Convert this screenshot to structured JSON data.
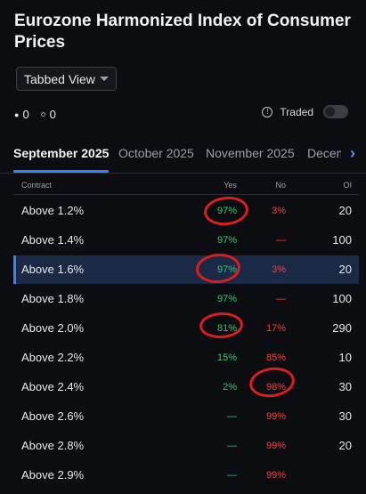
{
  "title": "Eurozone Harmonized Index of Consumer Prices",
  "view_select": {
    "value": "Tabbed View"
  },
  "counts": {
    "first": "0",
    "second": "0"
  },
  "traded": {
    "label": "Traded",
    "toggle_on": false
  },
  "tabs": [
    {
      "label": "September 2025",
      "active": true
    },
    {
      "label": "October 2025",
      "active": false
    },
    {
      "label": "November 2025",
      "active": false
    },
    {
      "label": "Decem",
      "active": false
    }
  ],
  "columns": {
    "contract": "Contract",
    "yes": "Yes",
    "no": "No",
    "oi": "OI"
  },
  "rows": [
    {
      "contract": "Above 1.2%",
      "yes": "97%",
      "no": "3%",
      "oi": "20"
    },
    {
      "contract": "Above 1.4%",
      "yes": "97%",
      "no": "—",
      "oi": "100"
    },
    {
      "contract": "Above 1.6%",
      "yes": "97%",
      "no": "3%",
      "oi": "20"
    },
    {
      "contract": "Above 1.8%",
      "yes": "97%",
      "no": "—",
      "oi": "100"
    },
    {
      "contract": "Above 2.0%",
      "yes": "81%",
      "no": "17%",
      "oi": "290"
    },
    {
      "contract": "Above 2.2%",
      "yes": "15%",
      "no": "85%",
      "oi": "10"
    },
    {
      "contract": "Above 2.4%",
      "yes": "2%",
      "no": "98%",
      "oi": "30"
    },
    {
      "contract": "Above 2.6%",
      "yes": "—",
      "no": "99%",
      "oi": "30"
    },
    {
      "contract": "Above 2.8%",
      "yes": "—",
      "no": "99%",
      "oi": "20"
    },
    {
      "contract": "Above 2.9%",
      "yes": "—",
      "no": "99%",
      "oi": ""
    }
  ],
  "colors": {
    "yes": "#2ecc71",
    "no": "#ef4444",
    "accent": "#3b82f6",
    "annotation": "#d81e1e"
  }
}
